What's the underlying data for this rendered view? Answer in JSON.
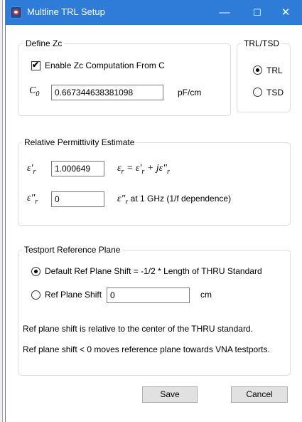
{
  "window": {
    "title": "Multline TRL Setup",
    "controls": {
      "minimize": "—",
      "maximize": "☐",
      "close": "✕"
    }
  },
  "define_zc": {
    "legend": "Define Zc",
    "enable_label": "Enable Zc Computation From C",
    "enable_checked": true,
    "c0_symbol": "C",
    "c0_subscript": "0",
    "c0_value": "0.667344638381098",
    "c0_unit": "pF/cm"
  },
  "trl_tsd": {
    "legend": "TRL/TSD",
    "options": [
      {
        "label": "TRL",
        "selected": true
      },
      {
        "label": "TSD",
        "selected": false
      }
    ]
  },
  "permittivity": {
    "legend": "Relative Permittivity Estimate",
    "real_symbol": "ε'",
    "real_sub": "r",
    "real_value": "1.000649",
    "formula_lhs": "ε",
    "formula_lhs_sub": "r",
    "formula_rhs_a": " = ε'",
    "formula_rhs_a_sub": "r",
    "formula_rhs_b": " + jε\"",
    "formula_rhs_b_sub": "r",
    "imag_symbol": "ε\"",
    "imag_sub": "r",
    "imag_value": "0",
    "imag_note_symbol": "ε\"",
    "imag_note_sub": "r",
    "imag_note": " at 1 GHz (1/f dependence)"
  },
  "testport": {
    "legend": "Testport Reference Plane",
    "default_label": "Default Ref Plane Shift = -1/2 * Length of THRU Standard",
    "default_selected": true,
    "shift_label": "Ref Plane Shift",
    "shift_value": "0",
    "shift_unit": "cm",
    "shift_selected": false,
    "note1": "Ref plane shift is relative to the center of the THRU standard.",
    "note2": "Ref plane shift < 0 moves reference plane towards VNA testports."
  },
  "buttons": {
    "save": "Save",
    "cancel": "Cancel"
  },
  "colors": {
    "titlebar": "#2f7bd8",
    "border": "#dcdcdc",
    "button_face": "#e1e1e1"
  }
}
